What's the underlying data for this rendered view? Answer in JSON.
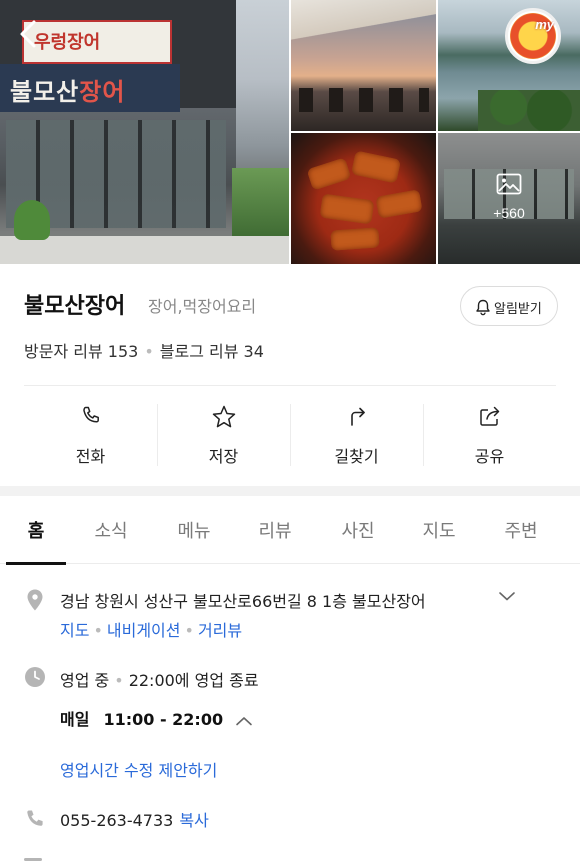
{
  "place": {
    "name": "불모산장어",
    "category": "장어,먹장어요리"
  },
  "photos": {
    "sign_top": "우렁장어",
    "sign_main_prefix": "불모산",
    "sign_main_suffix": "장어",
    "more_count": "+560",
    "badge_text": "my"
  },
  "notify": {
    "label": "알림받기"
  },
  "reviews": {
    "visitor": "방문자 리뷰 153",
    "blog": "블로그 리뷰 34"
  },
  "actions": [
    {
      "label": "전화",
      "icon": "phone-icon"
    },
    {
      "label": "저장",
      "icon": "star-icon"
    },
    {
      "label": "길찾기",
      "icon": "directions-icon"
    },
    {
      "label": "공유",
      "icon": "share-icon"
    }
  ],
  "tabs": [
    "홈",
    "소식",
    "메뉴",
    "리뷰",
    "사진",
    "지도",
    "주변"
  ],
  "address": {
    "text": "경남 창원시 성산구 불모산로66번길 8 1층 불모산장어",
    "links": [
      "지도",
      "내비게이션",
      "거리뷰"
    ]
  },
  "hours": {
    "status": "영업 중",
    "close_text": "22:00에 영업 종료",
    "days": "매일",
    "range": "11:00 - 22:00",
    "suggest_label": "영업시간 수정 제안하기"
  },
  "contact": {
    "phone": "055-263-4733",
    "copy_label": "복사"
  },
  "colors": {
    "link": "#2a6ad9",
    "muted": "#888888",
    "divider": "#ececec"
  }
}
